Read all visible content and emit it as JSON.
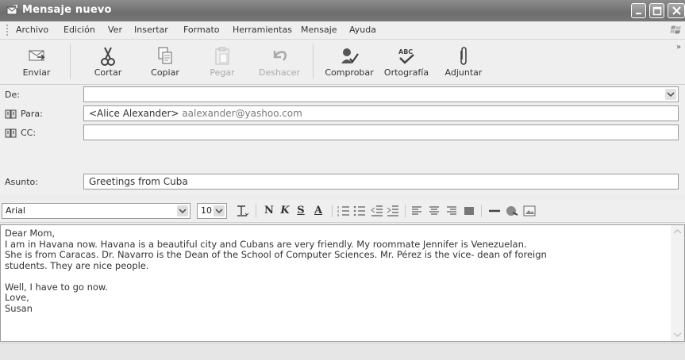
{
  "window": {
    "title": "Mensaje nuevo"
  },
  "menu": [
    "Archivo",
    "Edición",
    "Ver",
    "Insertar",
    "Formato",
    "Herramientas",
    "Mensaje",
    "Ayuda"
  ],
  "toolbar": {
    "send": "Enviar",
    "cut": "Cortar",
    "copy": "Copiar",
    "paste": "Pegar",
    "undo": "Deshacer",
    "check": "Comprobar",
    "spelling": "Ortografía",
    "attach": "Adjuntar"
  },
  "fields": {
    "from_label": "De:",
    "from_value": "",
    "to_label": "Para:",
    "to_name": "<Alice Alexander>",
    "to_email": "aalexander@yashoo.com",
    "cc_label": "CC:",
    "cc_value": "",
    "subject_label": "Asunto:",
    "subject_value": "Greetings from Cuba"
  },
  "format": {
    "font": "Arial",
    "size": "10",
    "bold": "N",
    "italic": "K",
    "underline": "S",
    "color": "A"
  },
  "message": {
    "lines": [
      "Dear Mom,",
      "I am in Havana now. Havana is a beautiful city and Cubans are very friendly. My roommate Jennifer is Venezuelan.",
      "She is from Caracas. Dr. Navarro is the Dean of the School of Computer Sciences. Mr. Pérez is the vice- dean of foreign",
      "students. They are nice people.",
      "",
      "Well, I have to go now.",
      "Love,",
      "Susan"
    ]
  }
}
